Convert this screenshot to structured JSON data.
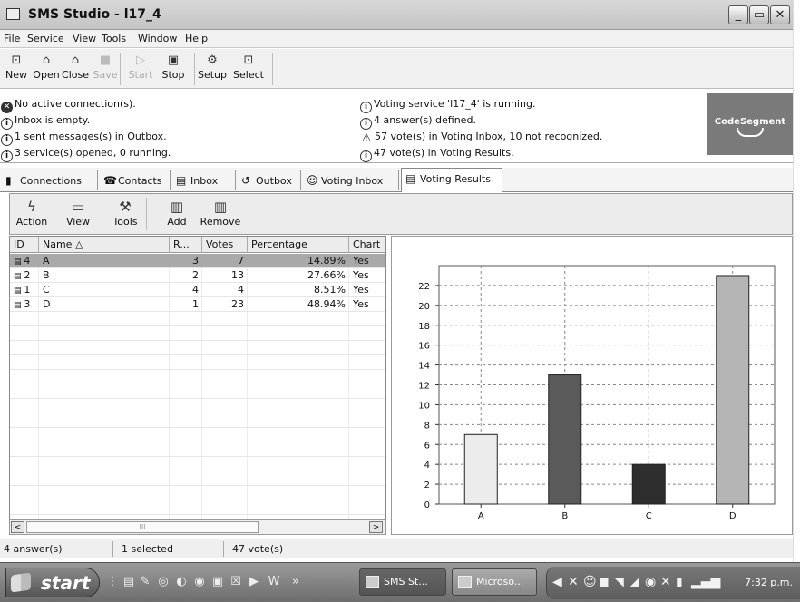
{
  "window": {
    "title": "SMS Studio - l17_4",
    "controls": {
      "minimize": "_",
      "restore": "▭",
      "close": "✕"
    }
  },
  "menu": [
    "File",
    "Service",
    "View",
    "Tools",
    "Window",
    "Help"
  ],
  "toolbar": [
    {
      "label": "New",
      "icon": "new-icon",
      "glyph": "⊡",
      "enabled": true
    },
    {
      "label": "Open",
      "icon": "open-icon",
      "glyph": "⌂",
      "enabled": true
    },
    {
      "label": "Close",
      "icon": "close-file-icon",
      "glyph": "⌂",
      "enabled": true
    },
    {
      "label": "Save",
      "icon": "save-icon",
      "glyph": "■",
      "enabled": false
    },
    {
      "label": "Start",
      "icon": "start-icon",
      "glyph": "▷",
      "enabled": false
    },
    {
      "label": "Stop",
      "icon": "stop-icon",
      "glyph": "▣",
      "enabled": true
    },
    {
      "label": "Setup",
      "icon": "setup-icon",
      "glyph": "⚙",
      "enabled": true
    },
    {
      "label": "Select",
      "icon": "select-icon",
      "glyph": "⊡",
      "enabled": true
    }
  ],
  "status": {
    "left": [
      {
        "icon": "error",
        "glyph": "✕",
        "text": "No active connection(s)."
      },
      {
        "icon": "info",
        "glyph": "i",
        "text": "Inbox is empty."
      },
      {
        "icon": "info",
        "glyph": "i",
        "text": "1 sent messages(s) in Outbox."
      },
      {
        "icon": "info",
        "glyph": "i",
        "text": "3 service(s) opened, 0 running."
      }
    ],
    "right": [
      {
        "icon": "info",
        "glyph": "i",
        "text": "Voting service 'l17_4' is running."
      },
      {
        "icon": "info",
        "glyph": "i",
        "text": "4 answer(s) defined."
      },
      {
        "icon": "warning",
        "glyph": "⚠",
        "text": "57 vote(s) in Voting Inbox, 10 not recognized."
      },
      {
        "icon": "info",
        "glyph": "i",
        "text": "47 vote(s) in Voting Results."
      }
    ],
    "logo": "CodeSegment"
  },
  "tabs": [
    {
      "label": "Connections",
      "glyph": "▮",
      "active": false
    },
    {
      "label": "Contacts",
      "glyph": "☎",
      "active": false
    },
    {
      "label": "Inbox",
      "glyph": "▤",
      "active": false
    },
    {
      "label": "Outbox",
      "glyph": "↺",
      "active": false
    },
    {
      "label": "Voting Inbox",
      "glyph": "☺",
      "active": false
    },
    {
      "label": "Voting Results",
      "glyph": "▤",
      "active": true
    }
  ],
  "subtoolbar": [
    {
      "label": "Action",
      "glyph": "ϟ"
    },
    {
      "label": "View",
      "glyph": "▭"
    },
    {
      "label": "Tools",
      "glyph": "⚒"
    },
    {
      "label": "Add",
      "glyph": "▥"
    },
    {
      "label": "Remove",
      "glyph": "▥"
    }
  ],
  "table": {
    "columns": [
      "ID",
      "Name △",
      "R...",
      "Votes",
      "Percentage",
      "Chart"
    ],
    "rows": [
      {
        "id": "4",
        "name": "A",
        "rank": "3",
        "votes": "7",
        "percentage": "14.89%",
        "chart": "Yes",
        "selected": true
      },
      {
        "id": "2",
        "name": "B",
        "rank": "2",
        "votes": "13",
        "percentage": "27.66%",
        "chart": "Yes",
        "selected": false
      },
      {
        "id": "1",
        "name": "C",
        "rank": "4",
        "votes": "4",
        "percentage": "8.51%",
        "chart": "Yes",
        "selected": false
      },
      {
        "id": "3",
        "name": "D",
        "rank": "1",
        "votes": "23",
        "percentage": "48.94%",
        "chart": "Yes",
        "selected": false
      }
    ],
    "scroll_left": "<",
    "scroll_right": ">",
    "scroll_grip": "III"
  },
  "chart_data": {
    "type": "bar",
    "categories": [
      "A",
      "B",
      "C",
      "D"
    ],
    "values": [
      7,
      13,
      4,
      23
    ],
    "colors": [
      "#ececec",
      "#5a5a5a",
      "#2e2e2e",
      "#b5b5b5"
    ],
    "ylim": [
      0,
      24
    ],
    "yticks": [
      0,
      2,
      4,
      6,
      8,
      10,
      12,
      14,
      16,
      18,
      20,
      22
    ],
    "grid": true
  },
  "statusbar": {
    "answers": "4 answer(s)",
    "selected": "1 selected",
    "votes": "47 vote(s)"
  },
  "taskbar": {
    "start": "start",
    "quicklaunch": [
      "⋮",
      "▤",
      "✎",
      "◎",
      "◐",
      "◉",
      "▣",
      "☒",
      "▶",
      "W",
      "»"
    ],
    "buttons": [
      {
        "label": "SMS St...",
        "active": true
      },
      {
        "label": "Microso...",
        "active": false
      }
    ],
    "tray": [
      "◀",
      "✕",
      "☺",
      "◼",
      "◥",
      "◢",
      "◉",
      "✕",
      "▮",
      "▂▄▆"
    ],
    "clock": "7:32 p.m."
  }
}
